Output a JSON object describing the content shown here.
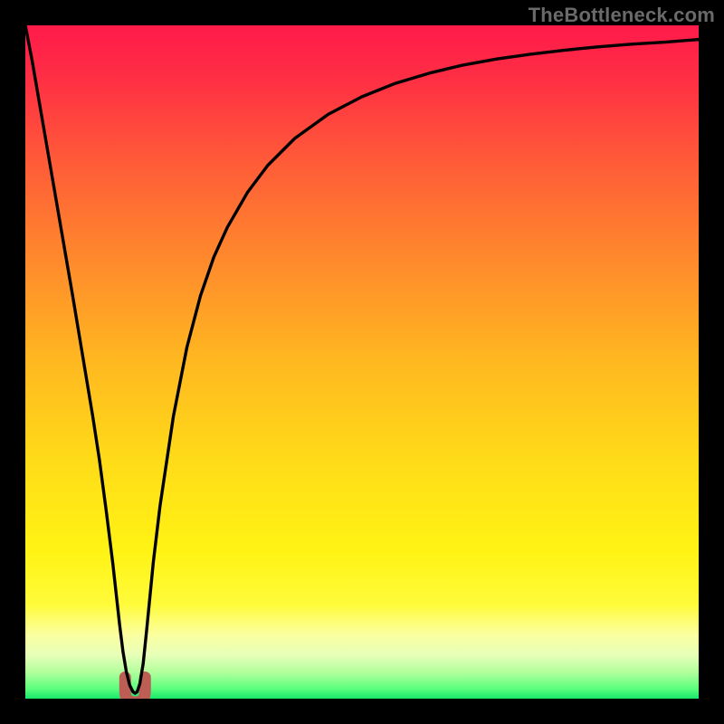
{
  "watermark": "TheBottleneck.com",
  "colors": {
    "frame": "#000000",
    "curve": "#000000",
    "accent_stub": "#bd5e55",
    "gradient_stops": [
      {
        "offset": 0.0,
        "color": "#ff1a4a"
      },
      {
        "offset": 0.08,
        "color": "#ff2f44"
      },
      {
        "offset": 0.2,
        "color": "#ff5a38"
      },
      {
        "offset": 0.35,
        "color": "#ff8a2c"
      },
      {
        "offset": 0.5,
        "color": "#ffb820"
      },
      {
        "offset": 0.65,
        "color": "#ffdc18"
      },
      {
        "offset": 0.78,
        "color": "#fff314"
      },
      {
        "offset": 0.86,
        "color": "#fffb3a"
      },
      {
        "offset": 0.905,
        "color": "#fbffa0"
      },
      {
        "offset": 0.935,
        "color": "#e7ffb8"
      },
      {
        "offset": 0.96,
        "color": "#b4ff9e"
      },
      {
        "offset": 0.985,
        "color": "#5dff7e"
      },
      {
        "offset": 1.0,
        "color": "#17e86b"
      }
    ]
  },
  "chart_data": {
    "type": "line",
    "title": "",
    "xlabel": "",
    "ylabel": "",
    "xlim": [
      0,
      100
    ],
    "ylim": [
      0,
      100
    ],
    "grid": false,
    "legend": false,
    "x": [
      0,
      1,
      2,
      3,
      4,
      5,
      6,
      7,
      8,
      9,
      10,
      11,
      12,
      13,
      13.5,
      14,
      14.5,
      15,
      15.5,
      16,
      16.3,
      16.6,
      17,
      17.5,
      18,
      19,
      20,
      22,
      24,
      26,
      28,
      30,
      33,
      36,
      40,
      45,
      50,
      55,
      60,
      65,
      70,
      75,
      80,
      85,
      90,
      95,
      100
    ],
    "series": [
      {
        "name": "bottleneck-v-curve",
        "values": [
          100,
          94.8,
          89,
          83.2,
          77.4,
          71.6,
          65.8,
          60,
          54,
          48,
          42,
          35.5,
          28,
          20,
          15.5,
          11,
          7,
          4,
          2,
          1,
          0.8,
          1,
          2.2,
          5.2,
          10,
          20.2,
          28.6,
          42,
          52.2,
          59.8,
          65.6,
          70,
          75.2,
          79.2,
          83.2,
          86.8,
          89.4,
          91.4,
          92.9,
          94.1,
          95,
          95.7,
          96.3,
          96.8,
          97.2,
          97.5,
          97.9
        ]
      }
    ],
    "annotations": [
      {
        "text": "accent-stub",
        "x": 16.3,
        "y": 1.5
      }
    ]
  }
}
